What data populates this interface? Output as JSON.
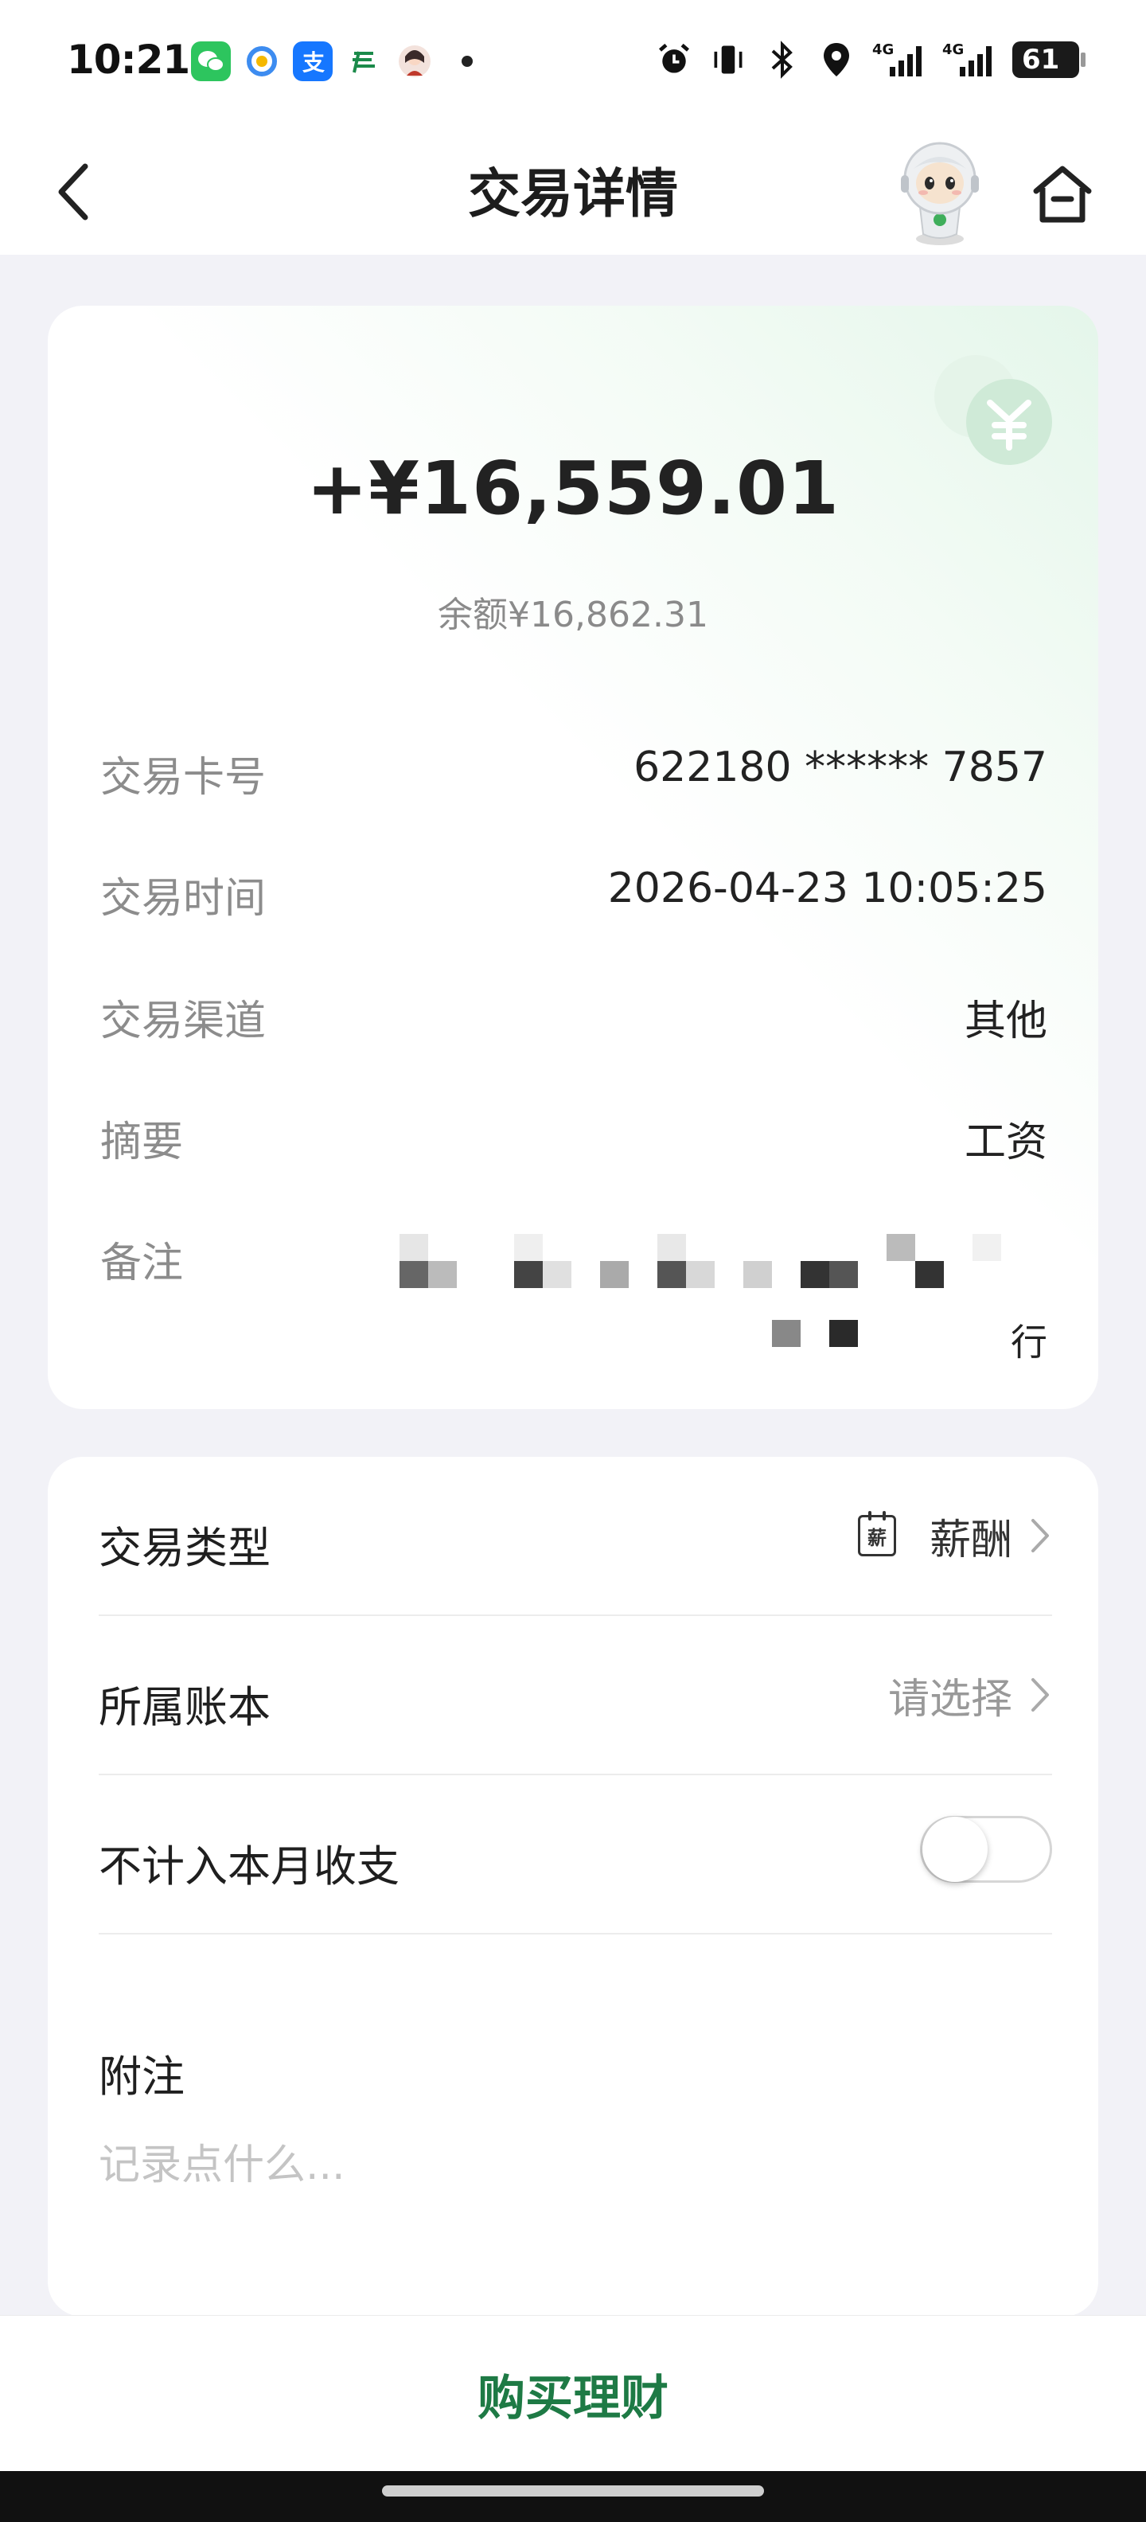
{
  "status_bar": {
    "time": "10:21",
    "app_icons": [
      "wechat-icon",
      "qq-browser-icon",
      "alipay-icon",
      "post-bank-icon",
      "avatar-icon"
    ],
    "network_1": "4G",
    "network_2": "4G",
    "battery": "61"
  },
  "header": {
    "title": "交易详情"
  },
  "transaction": {
    "amount": "+¥16,559.01",
    "balance": "余额¥16,862.31",
    "rows": [
      {
        "label": "交易卡号",
        "value": "622180 ****** 7857"
      },
      {
        "label": "交易时间",
        "value": "2026-04-23 10:05:25"
      },
      {
        "label": "交易渠道",
        "value": "其他"
      },
      {
        "label": "摘要",
        "value": "工资"
      },
      {
        "label": "备注",
        "value": ""
      }
    ],
    "remark_tail": "行"
  },
  "settings": {
    "type_label": "交易类型",
    "type_icon_text": "薪",
    "type_value": "薪酬",
    "book_label": "所属账本",
    "book_value": "请选择",
    "exclude_label": "不计入本月收支",
    "exclude_enabled": false,
    "note_label": "附注",
    "note_placeholder": "记录点什么..."
  },
  "action": {
    "buy_label": "购买理财"
  },
  "colors": {
    "accent_green": "#1e7a45",
    "background": "#f2f2f7"
  }
}
